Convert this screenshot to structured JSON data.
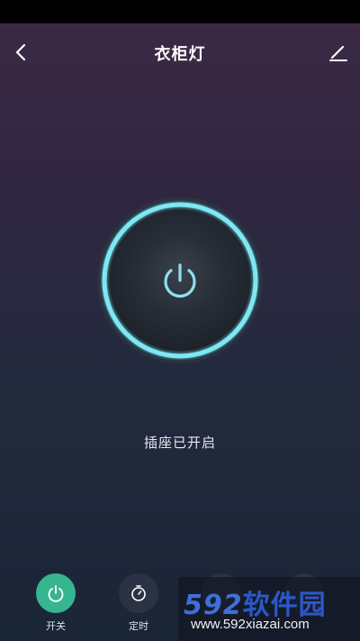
{
  "header": {
    "title": "衣柜灯",
    "back_icon": "chevron-left-icon",
    "edit_icon": "pencil-icon"
  },
  "device": {
    "status_text": "插座已开启",
    "power_on": true,
    "ring_color": "#7fe6f4",
    "icon_color": "#8fe0ee"
  },
  "nav": {
    "items": [
      {
        "label": "开关",
        "icon": "power-icon",
        "active": true,
        "color": "#36b58f"
      },
      {
        "label": "定时",
        "icon": "timer-icon",
        "active": false,
        "color": "#2a3244"
      },
      {
        "label": "",
        "icon": "unknown-icon",
        "active": false
      },
      {
        "label": "",
        "icon": "unknown-icon",
        "active": false
      }
    ]
  },
  "watermark": {
    "brand_digits": "592",
    "brand_cn": "软件园",
    "site": "www.592xiazai.com"
  }
}
